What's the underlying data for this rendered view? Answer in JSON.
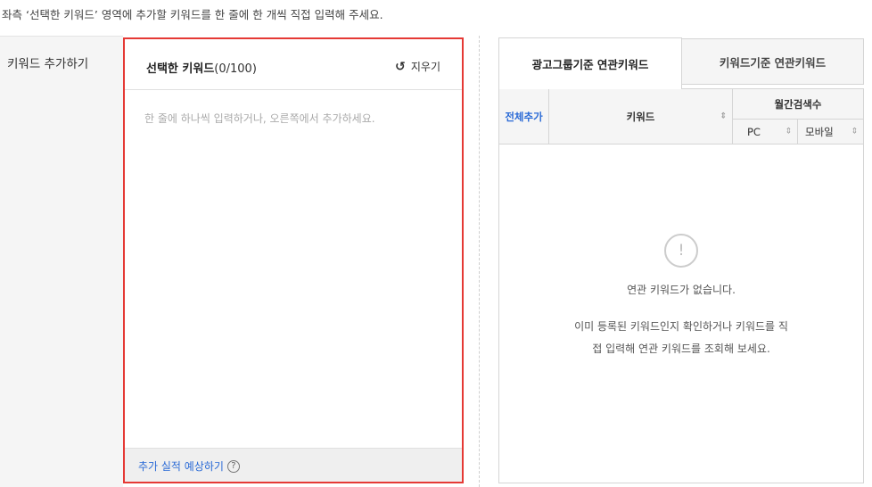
{
  "instruction": "좌측 ‘선택한 키워드’ 영역에 추가할 키워드를 한 줄에 한 개씩 직접 입력해 주세요.",
  "left_label": "키워드 추가하기",
  "selected": {
    "title": "선택한 키워드",
    "count": "(0/100)",
    "clear_icon": "refresh-icon",
    "clear_label": "지우기",
    "placeholder": "한 줄에 하나씩 입력하거나, 오른쪽에서 추가하세요.",
    "forecast_label": "추가 실적 예상하기",
    "help_icon": "?"
  },
  "tabs": [
    {
      "label": "광고그룹기준 연관키워드",
      "active": true
    },
    {
      "label": "키워드기준 연관키워드",
      "active": false
    }
  ],
  "table": {
    "add_all": "전체추가",
    "keyword": "키워드",
    "monthly": "월간검색수",
    "pc": "PC",
    "mobile": "모바일",
    "sort_icon": "⇕"
  },
  "empty": {
    "icon": "!",
    "title": "연관 키워드가 없습니다.",
    "desc": "이미 등록된 키워드인지 확인하거나 키워드를 직접 입력해 연관 키워드를 조회해 보세요."
  }
}
